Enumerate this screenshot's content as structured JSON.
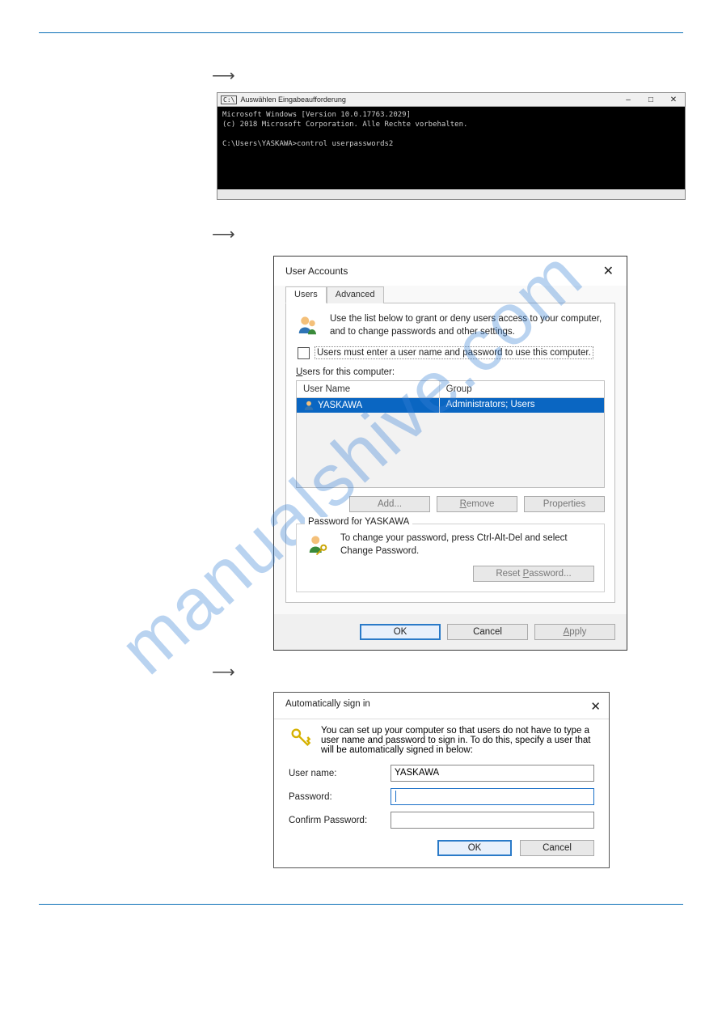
{
  "watermark": "manualshive.com",
  "cmd": {
    "title": "Auswählen Eingabeaufforderung",
    "line1": "Microsoft Windows [Version 10.0.17763.2029]",
    "line2": "(c) 2018 Microsoft Corporation. Alle Rechte vorbehalten.",
    "line3": "",
    "prompt": "C:\\Users\\YASKAWA>control userpasswords2"
  },
  "userAccounts": {
    "title": "User Accounts",
    "tabs": {
      "users": "Users",
      "advanced": "Advanced"
    },
    "intro": "Use the list below to grant or deny users access to your computer, and to change passwords and other settings.",
    "checkboxLabel": "Users must enter a user name and password to use this computer.",
    "usersForLabel": "Users for this computer:",
    "usersForUnderline": "U",
    "columns": {
      "userName": "User Name",
      "group": "Group"
    },
    "row": {
      "user": "YASKAWA",
      "group": "Administrators; Users"
    },
    "buttons": {
      "add": "Add...",
      "remove": "Remove",
      "properties": "Properties"
    },
    "passwordFor": "Password for YASKAWA",
    "passwordIntro": "To change your password, press Ctrl-Alt-Del and select Change Password.",
    "resetPassword": "Reset Password...",
    "footer": {
      "ok": "OK",
      "cancel": "Cancel",
      "apply": "Apply"
    }
  },
  "autoSignIn": {
    "title": "Automatically sign in",
    "intro": "You can set up your computer so that users do not have to type a user name and password to sign in. To do this, specify a user that will be automatically signed in below:",
    "labels": {
      "username": "User name:",
      "password": "Password:",
      "confirm": "Confirm Password:"
    },
    "values": {
      "username": "YASKAWA",
      "password": "",
      "confirm": ""
    },
    "footer": {
      "ok": "OK",
      "cancel": "Cancel"
    }
  }
}
